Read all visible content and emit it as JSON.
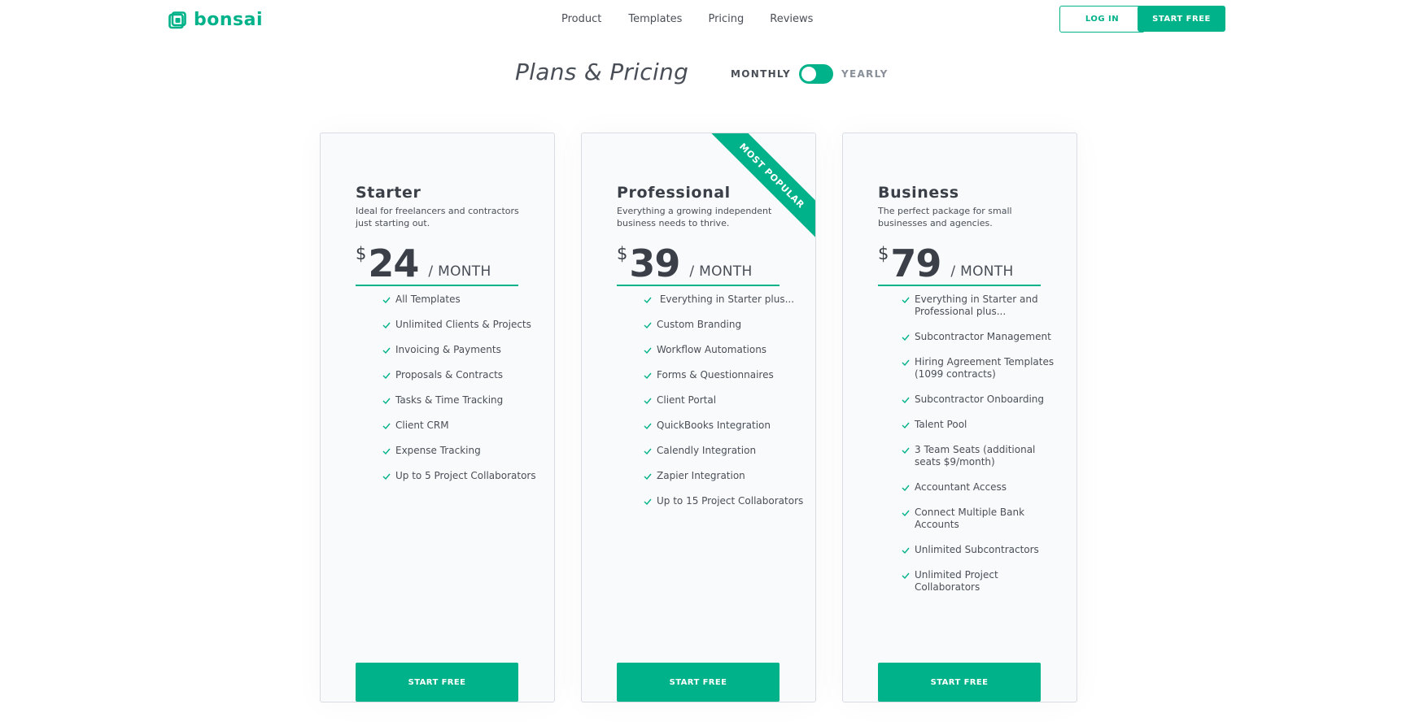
{
  "brand": {
    "name": "bonsai",
    "color": "#00b289"
  },
  "nav": {
    "items": [
      {
        "label": "Product"
      },
      {
        "label": "Templates"
      },
      {
        "label": "Pricing"
      },
      {
        "label": "Reviews"
      }
    ],
    "login_label": "LOG IN",
    "start_label": "START FREE"
  },
  "pricing_header": {
    "title": "Plans & Pricing",
    "toggle": {
      "left": "MONTHLY",
      "right": "YEARLY",
      "selected": "MONTHLY"
    }
  },
  "plans": [
    {
      "name": "Starter",
      "description": "Ideal for freelancers and contractors just starting out.",
      "currency": "$",
      "price": "24",
      "period": "/ MONTH",
      "features": [
        "All Templates",
        "Unlimited Clients & Projects",
        "Invoicing & Payments",
        "Proposals & Contracts",
        "Tasks & Time Tracking",
        "Client CRM",
        "Expense Tracking",
        "Up to 5 Project Collaborators"
      ],
      "cta": "START FREE"
    },
    {
      "name": "Professional",
      "description": "Everything a growing independent business needs to thrive.",
      "badge": "MOST POPULAR",
      "currency": "$",
      "price": "39",
      "period": "/ MONTH",
      "features": [
        " Everything in Starter plus...",
        "Custom Branding",
        "Workflow Automations",
        "Forms & Questionnaires",
        "Client Portal",
        "QuickBooks Integration",
        "Calendly Integration",
        "Zapier Integration",
        "Up to 15 Project Collaborators"
      ],
      "cta": "START FREE"
    },
    {
      "name": "Business",
      "description": "The perfect package for small businesses and agencies.",
      "currency": "$",
      "price": "79",
      "period": "/ MONTH",
      "features": [
        "Everything in Starter and Professional plus...",
        "Subcontractor Management",
        "Hiring Agreement Templates (1099 contracts)",
        "Subcontractor Onboarding",
        "Talent Pool",
        "3 Team Seats (additional seats $9/month)",
        "Accountant Access",
        "Connect Multiple Bank Accounts",
        "Unlimited Subcontractors",
        "Unlimited Project Collaborators"
      ],
      "cta": "START FREE"
    }
  ]
}
